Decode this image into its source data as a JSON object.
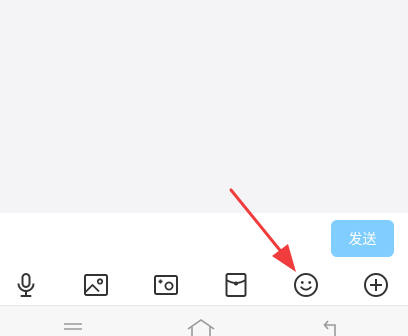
{
  "chat": {
    "input_value": "",
    "send_label": "发送"
  },
  "toolbar": {
    "items": [
      {
        "icon": "microphone-icon"
      },
      {
        "icon": "image-icon"
      },
      {
        "icon": "camera-icon"
      },
      {
        "icon": "red-envelope-icon"
      },
      {
        "icon": "emoji-icon",
        "highlighted": true
      },
      {
        "icon": "plus-circle-icon"
      }
    ]
  },
  "navbar": {
    "items": [
      {
        "icon": "menu-icon"
      },
      {
        "icon": "home-icon"
      },
      {
        "icon": "back-icon"
      }
    ]
  },
  "colors": {
    "send_button_bg": "#7fcefd",
    "icon_stroke": "#333333",
    "annotation_arrow": "#f03c3c",
    "nav_icon": "#9a9a9a"
  }
}
